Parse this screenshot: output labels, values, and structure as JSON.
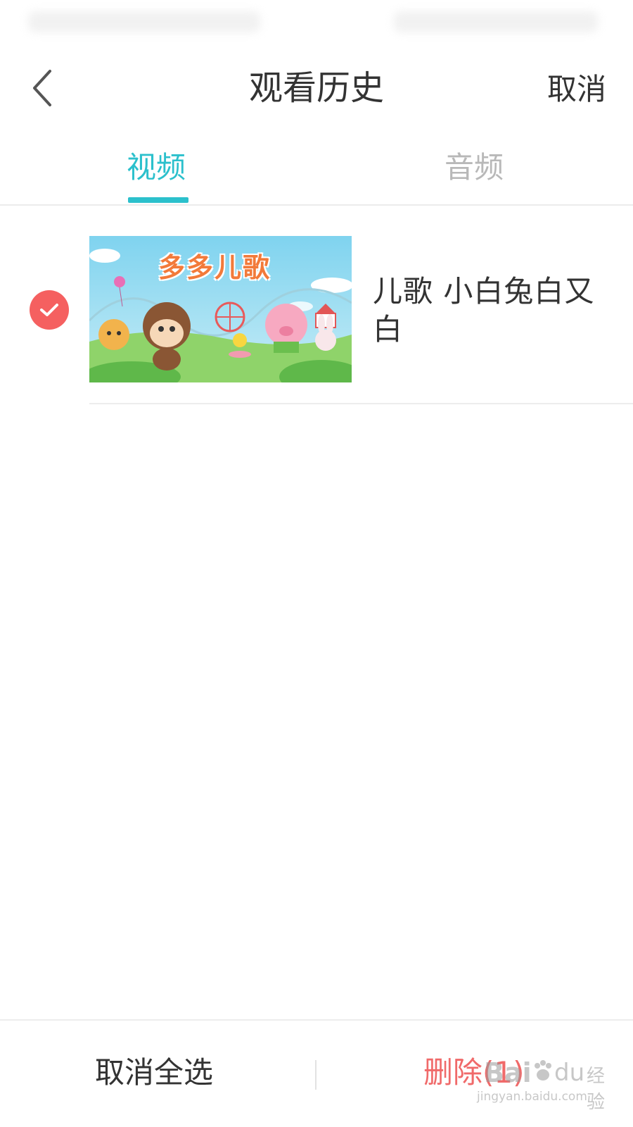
{
  "header": {
    "title": "观看历史",
    "cancel_label": "取消"
  },
  "tabs": [
    {
      "label": "视频",
      "active": true
    },
    {
      "label": "音频",
      "active": false
    }
  ],
  "history": [
    {
      "thumbnail_logo": "多多儿歌",
      "title": "儿歌  小白兔白又白",
      "selected": true
    }
  ],
  "footer": {
    "deselect_all_label": "取消全选",
    "delete_label": "删除(1)"
  },
  "watermark": {
    "text_left": "Bai",
    "text_right": "du",
    "text_cn": "经验",
    "url": "jingyan.baidu.com"
  },
  "colors": {
    "accent": "#2bc0cc",
    "danger": "#f56060",
    "text": "#333333",
    "muted": "#b8b8b8"
  },
  "icons": {
    "back": "chevron-left-icon",
    "check": "check-icon"
  }
}
